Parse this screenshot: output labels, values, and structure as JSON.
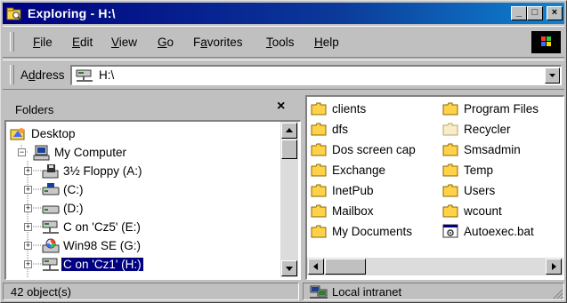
{
  "window": {
    "title": "Exploring - H:\\",
    "minimize_glyph": "_",
    "maximize_glyph": "□",
    "close_glyph": "×"
  },
  "menu": [
    {
      "label_u": "F",
      "label_rest": "ile"
    },
    {
      "label_u": "E",
      "label_rest": "dit"
    },
    {
      "label_u": "V",
      "label_rest": "iew"
    },
    {
      "label_u": "G",
      "label_rest": "o"
    },
    {
      "label_pre": "F",
      "label_u": "a",
      "label_rest": "vorites"
    },
    {
      "label_u": "T",
      "label_rest": "ools"
    },
    {
      "label_u": "H",
      "label_rest": "elp"
    }
  ],
  "address": {
    "label_pre": "A",
    "label_u": "d",
    "label_rest": "dress",
    "value": "H:\\"
  },
  "folders": {
    "title": "Folders",
    "close_glyph": "×",
    "tree": [
      {
        "label": "Desktop",
        "icon": "desktop-icon"
      },
      {
        "label": "My Computer",
        "icon": "my-computer-icon"
      },
      {
        "label": "3½ Floppy (A:)",
        "icon": "floppy-drive-icon"
      },
      {
        "label": "(C:)",
        "icon": "hard-drive-icon"
      },
      {
        "label": "(D:)",
        "icon": "hard-drive-icon"
      },
      {
        "label": "C on 'Cz5' (E:)",
        "icon": "network-drive-icon"
      },
      {
        "label": "Win98 SE (G:)",
        "icon": "cd-drive-icon"
      },
      {
        "label": "C on 'Cz1' (H:)",
        "icon": "network-drive-icon",
        "selected": true
      }
    ]
  },
  "files": {
    "items": [
      {
        "label": "clients",
        "icon": "folder-icon"
      },
      {
        "label": "dfs",
        "icon": "folder-icon"
      },
      {
        "label": "Dos screen cap",
        "icon": "folder-icon"
      },
      {
        "label": "Exchange",
        "icon": "folder-icon"
      },
      {
        "label": "InetPub",
        "icon": "folder-icon"
      },
      {
        "label": "Mailbox",
        "icon": "folder-icon"
      },
      {
        "label": "My Documents",
        "icon": "folder-icon"
      },
      {
        "label": "Program Files",
        "icon": "folder-icon"
      },
      {
        "label": "Recycler",
        "icon": "folder-hidden-icon"
      },
      {
        "label": "Smsadmin",
        "icon": "folder-icon"
      },
      {
        "label": "Temp",
        "icon": "folder-icon"
      },
      {
        "label": "Users",
        "icon": "folder-icon"
      },
      {
        "label": "wcount",
        "icon": "folder-icon"
      },
      {
        "label": "Autoexec.bat",
        "icon": "batch-file-icon"
      }
    ]
  },
  "status": {
    "objects": "42 object(s)",
    "zone": "Local intranet"
  },
  "colors": {
    "title_start": "#000080",
    "title_end": "#1084d0",
    "selection": "#000080",
    "folder": "#ffd24a"
  }
}
